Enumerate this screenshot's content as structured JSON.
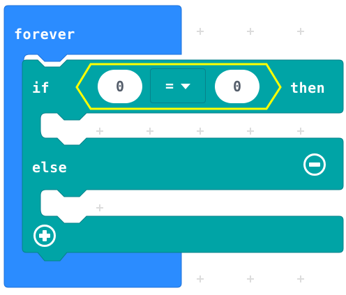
{
  "forever_block": {
    "label": "forever",
    "color": "#2b8cff"
  },
  "if_block": {
    "if_label": "if",
    "then_label": "then",
    "else_label": "else",
    "color": "#00a4a6"
  },
  "condition": {
    "left_value": "0",
    "operator": "=",
    "right_value": "0",
    "highlight_color": "#ffff00"
  },
  "icons": {
    "remove_else": "minus-circle-icon",
    "add_branch": "plus-circle-icon",
    "dropdown": "caret-down-icon"
  }
}
